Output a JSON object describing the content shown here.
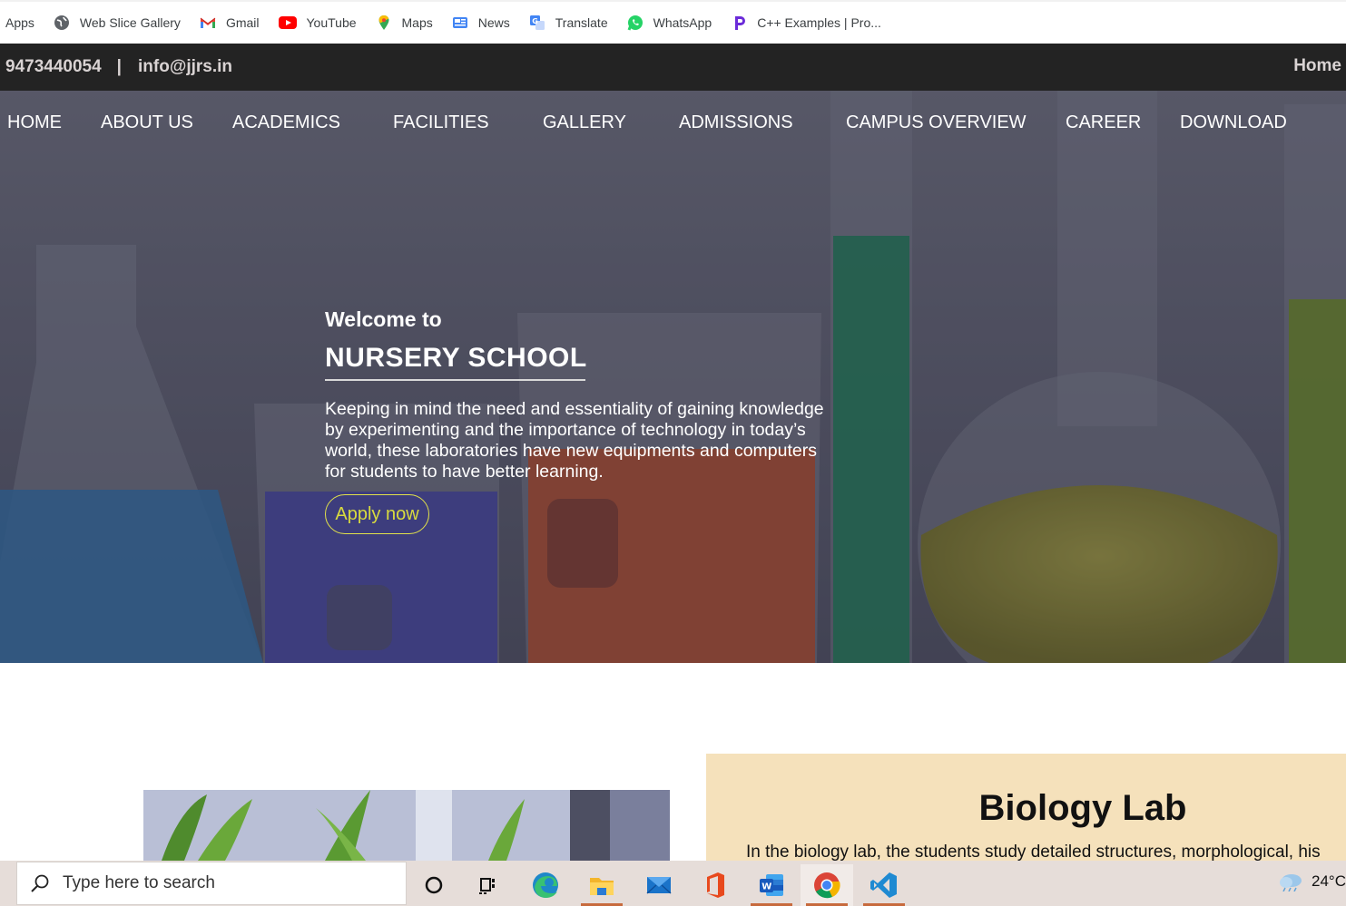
{
  "bookmarks": [
    {
      "label": "Apps",
      "icon": "apps-icon"
    },
    {
      "label": "Web Slice Gallery",
      "icon": "globe-icon"
    },
    {
      "label": "Gmail",
      "icon": "gmail-icon"
    },
    {
      "label": "YouTube",
      "icon": "youtube-icon"
    },
    {
      "label": "Maps",
      "icon": "maps-pin-icon"
    },
    {
      "label": "News",
      "icon": "news-icon"
    },
    {
      "label": "Translate",
      "icon": "translate-icon"
    },
    {
      "label": "WhatsApp",
      "icon": "whatsapp-icon"
    },
    {
      "label": "C++ Examples | Pro...",
      "icon": "programiz-icon"
    }
  ],
  "topbar": {
    "phone": "9473440054",
    "separator": "|",
    "email": "info@jjrs.in",
    "home": "Home"
  },
  "nav": [
    "HOME",
    "ABOUT US",
    "ACADEMICS",
    "FACILITIES",
    "GALLERY",
    "ADMISSIONS",
    "CAMPUS OVERVIEW",
    "CAREER",
    "DOWNLOAD"
  ],
  "hero": {
    "welcome": "Welcome to",
    "title": "NURSERY SCHOOL",
    "description": "Keeping in mind the need and essentiality of gaining knowledge by experimenting and the importance of technology in today’s world, these laboratories have new equipments and computers for students to have better learning.",
    "apply": "Apply now"
  },
  "lab": {
    "title": "Biology Lab",
    "text": "In the biology lab, the students study detailed structures, morphological, his"
  },
  "taskbar": {
    "search_placeholder": "Type here to search",
    "apps": [
      "cortana-icon",
      "task-view-icon",
      "edge-icon",
      "file-explorer-icon",
      "mail-icon",
      "office-icon",
      "word-icon",
      "chrome-icon",
      "vscode-icon"
    ],
    "weather": "24°C"
  },
  "colors": {
    "topbar_bg": "#232323",
    "apply_accent": "#d9db3e",
    "lab_card_bg": "#f5e1bb",
    "taskbar_bg": "#e6ddd9"
  }
}
